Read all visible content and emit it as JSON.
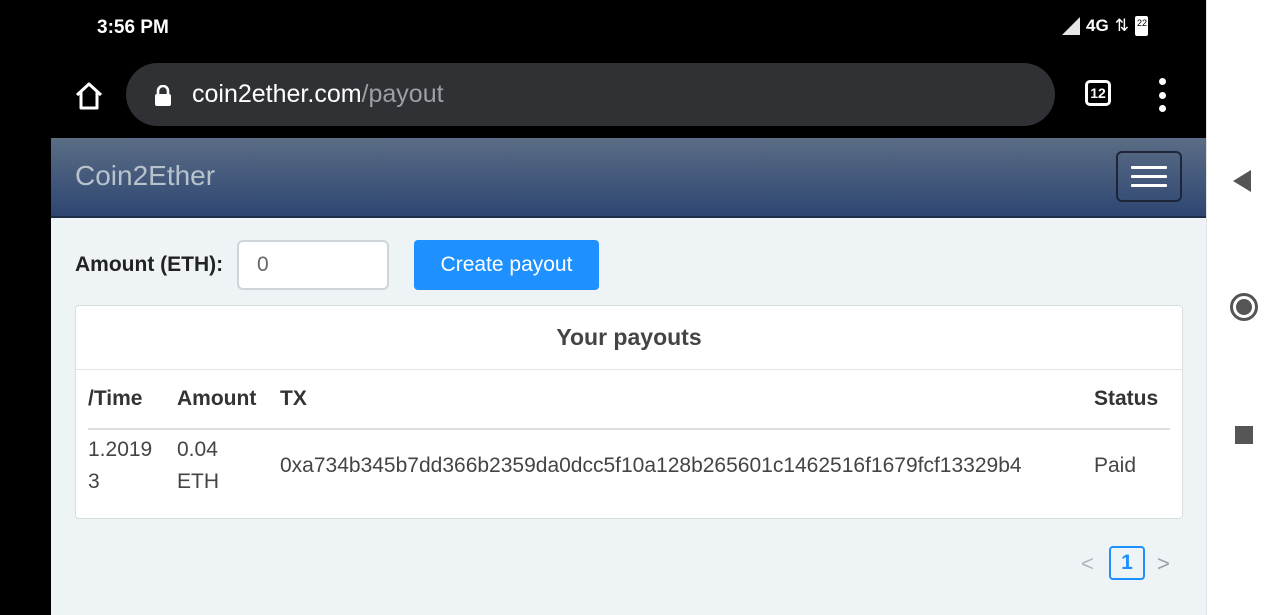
{
  "status_bar": {
    "time": "3:56 PM",
    "network": "4G",
    "battery": "22"
  },
  "browser": {
    "url_domain": "coin2ether.com",
    "url_path": "/payout",
    "tab_count": "12"
  },
  "navbar": {
    "brand": "Coin2Ether"
  },
  "form": {
    "amount_label": "Amount (ETH):",
    "amount_value": "0",
    "create_button": "Create payout"
  },
  "payouts": {
    "title": "Your payouts",
    "columns": [
      "/Time",
      "Amount",
      "TX",
      "Status"
    ],
    "rows": [
      {
        "date_line1": "1.2019",
        "date_line2": "3",
        "amount_line1": "0.04",
        "amount_line2": "ETH",
        "tx": "0xa734b345b7dd366b2359da0dcc5f10a128b265601c1462516f1679fcf13329b4",
        "status": "Paid"
      }
    ]
  },
  "pagination": {
    "prev": "<",
    "current": "1",
    "next": ">"
  }
}
